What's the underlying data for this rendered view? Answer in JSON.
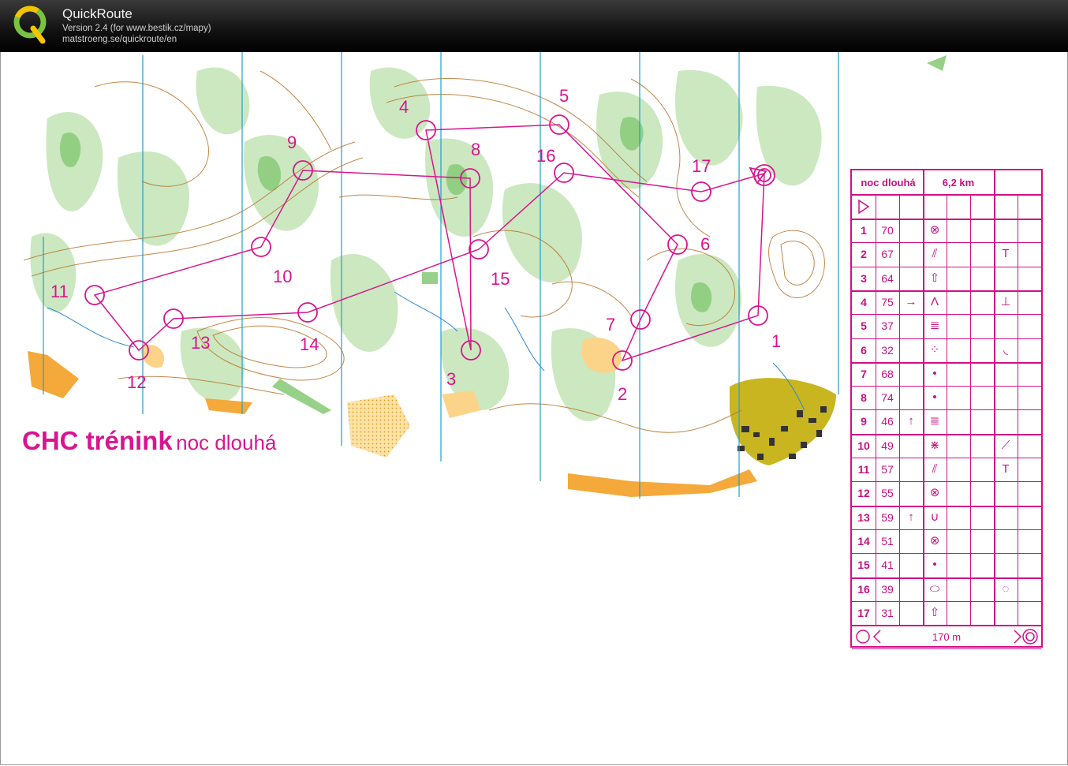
{
  "app": {
    "title": "QuickRoute",
    "version": "Version 2.4  (for www.bestik.cz/mapy)",
    "url": "matstroeng.se/quickroute/en"
  },
  "map": {
    "course_caption_bold": "CHC trénink",
    "course_caption_rest": "noc dlouhá",
    "overprint_color": "#d8158f",
    "control_labels": [
      "1",
      "2",
      "3",
      "4",
      "5",
      "6",
      "7",
      "8",
      "9",
      "10",
      "11",
      "12",
      "13",
      "14",
      "15",
      "16",
      "17"
    ]
  },
  "description": {
    "course_name": "noc dlouhá",
    "length": "6,2 km",
    "finish_distance": "170 m",
    "rows": [
      {
        "n": "1",
        "code": "70",
        "dir": "",
        "feat": "⊗",
        "app": ""
      },
      {
        "n": "2",
        "code": "67",
        "dir": "",
        "feat": "⫽",
        "app": "T"
      },
      {
        "n": "3",
        "code": "64",
        "dir": "",
        "feat": "⇧",
        "app": ""
      },
      {
        "n": "4",
        "code": "75",
        "dir": "→",
        "feat": "Λ",
        "app": "⊥"
      },
      {
        "n": "5",
        "code": "37",
        "dir": "",
        "feat": "≣",
        "app": ""
      },
      {
        "n": "6",
        "code": "32",
        "dir": "",
        "feat": "⁘",
        "app": "◟"
      },
      {
        "n": "7",
        "code": "68",
        "dir": "",
        "feat": "•",
        "app": ""
      },
      {
        "n": "8",
        "code": "74",
        "dir": "",
        "feat": "•",
        "app": ""
      },
      {
        "n": "9",
        "code": "46",
        "dir": "↑",
        "feat": "≣",
        "app": ""
      },
      {
        "n": "10",
        "code": "49",
        "dir": "",
        "feat": "⋇",
        "app": "⟋"
      },
      {
        "n": "11",
        "code": "57",
        "dir": "",
        "feat": "⫽",
        "app": "T"
      },
      {
        "n": "12",
        "code": "55",
        "dir": "",
        "feat": "⊗",
        "app": ""
      },
      {
        "n": "13",
        "code": "59",
        "dir": "↑",
        "feat": "∪",
        "app": ""
      },
      {
        "n": "14",
        "code": "51",
        "dir": "",
        "feat": "⊗",
        "app": ""
      },
      {
        "n": "15",
        "code": "41",
        "dir": "",
        "feat": "•",
        "app": ""
      },
      {
        "n": "16",
        "code": "39",
        "dir": "",
        "feat": "⬭",
        "app": "◌"
      },
      {
        "n": "17",
        "code": "31",
        "dir": "",
        "feat": "⇧",
        "app": ""
      }
    ]
  }
}
